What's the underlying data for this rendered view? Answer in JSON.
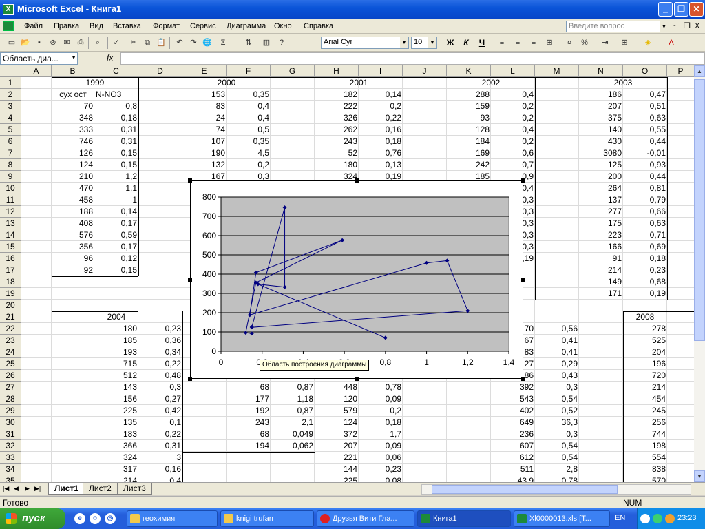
{
  "window": {
    "title": "Microsoft Excel - Книга1",
    "min": "_",
    "max": "❐",
    "close": "✕"
  },
  "menu": [
    "Файл",
    "Правка",
    "Вид",
    "Вставка",
    "Формат",
    "Сервис",
    "Диаграмма",
    "Окно",
    "Справка"
  ],
  "ask_placeholder": "Введите вопрос",
  "doc_controls": {
    "min": "-",
    "restore": "❐",
    "close": "x"
  },
  "toolbar": {
    "font": "Arial Cyr",
    "size": "10",
    "bold": "Ж",
    "italic": "К",
    "underline": "Ч",
    "sigma": "Σ",
    "percent": "%"
  },
  "namebox": "Область диа...",
  "fx": "fx",
  "columns": [
    "A",
    "B",
    "C",
    "D",
    "E",
    "F",
    "G",
    "H",
    "I",
    "J",
    "K",
    "L",
    "M",
    "N",
    "O",
    "P"
  ],
  "rows": [
    "1",
    "2",
    "3",
    "4",
    "5",
    "6",
    "7",
    "8",
    "9",
    "10",
    "11",
    "12",
    "13",
    "14",
    "15",
    "16",
    "17",
    "18",
    "19",
    "20",
    "21",
    "22",
    "23",
    "24",
    "25",
    "26",
    "27",
    "28",
    "29",
    "30",
    "31",
    "32",
    "33",
    "34",
    "35"
  ],
  "years_row1": [
    "1999",
    "2000",
    "2001",
    "2002",
    "2003"
  ],
  "headers": {
    "b2": "сух ост",
    "c2": "N-NO3"
  },
  "data1999": {
    "B": [
      "70",
      "348",
      "333",
      "746",
      "126",
      "124",
      "210",
      "470",
      "458",
      "188",
      "408",
      "576",
      "356",
      "96",
      "92"
    ],
    "C": [
      "0,8",
      "0,18",
      "0,31",
      "0,31",
      "0,15",
      "0,15",
      "1,2",
      "1,1",
      "1",
      "0,14",
      "0,17",
      "0,59",
      "0,17",
      "0,12",
      "0,15"
    ]
  },
  "data2000": {
    "E": [
      "153",
      "83",
      "24",
      "74",
      "107",
      "190",
      "132",
      "167"
    ],
    "F": [
      "0,35",
      "0,4",
      "0,4",
      "0,5",
      "0,35",
      "4,5",
      "0,2",
      "0,3"
    ]
  },
  "data2001": {
    "H": [
      "182",
      "222",
      "326",
      "262",
      "243",
      "52",
      "180",
      "324"
    ],
    "I": [
      "0,14",
      "0,2",
      "0,22",
      "0,16",
      "0,18",
      "0,76",
      "0,13",
      "0,19"
    ]
  },
  "data2002": {
    "K": [
      "288",
      "159",
      "93",
      "128",
      "184",
      "169",
      "242",
      "185"
    ],
    "L": [
      "0,4",
      "0,2",
      "0,2",
      "0,4",
      "0,2",
      "0,6",
      "0,7",
      "0,9",
      "0,4",
      "0,3",
      "0,3",
      "0,3",
      "0,3",
      "0,3",
      "0,19"
    ]
  },
  "data2003": {
    "N": [
      "186",
      "207",
      "375",
      "140",
      "430",
      "3080",
      "125",
      "200",
      "264",
      "137",
      "277",
      "175",
      "223",
      "166",
      "91",
      "214",
      "149",
      "171"
    ],
    "O": [
      "0,47",
      "0,51",
      "0,63",
      "0,55",
      "0,44",
      "-0,01",
      "0,93",
      "0,44",
      "0,81",
      "0,79",
      "0,66",
      "0,63",
      "0,71",
      "0,69",
      "0,18",
      "0,23",
      "0,68",
      "0,19"
    ]
  },
  "years_row21": {
    "y2004": "2004",
    "y2008": "2008"
  },
  "data2004": {
    "C": [
      "180",
      "185",
      "193",
      "715",
      "512",
      "143",
      "156",
      "225",
      "135",
      "183",
      "366",
      "324",
      "317",
      "214"
    ],
    "D": [
      "0,23",
      "0,36",
      "0,34",
      "0,22",
      "0,48",
      "0,3",
      "0,27",
      "0,42",
      "0,1",
      "0,22",
      "0,31",
      "3",
      "0,16",
      "0,4"
    ]
  },
  "data2005": {
    "F": [
      "68",
      "177",
      "192",
      "243",
      "68",
      "194"
    ],
    "G": [
      "0,87",
      "1,18",
      "0,87",
      "2,1",
      "0,049",
      "0,062"
    ]
  },
  "data2006": {
    "H": [
      "448",
      "120",
      "579",
      "124",
      "372",
      "207",
      "221",
      "144",
      "225"
    ],
    "I": [
      "0,78",
      "0,09",
      "0,2",
      "0,18",
      "1,7",
      "0,09",
      "0,06",
      "0,23",
      "0,08"
    ]
  },
  "data2007": {
    "L": [
      "70",
      "67",
      "83",
      "27",
      "86",
      "392",
      "543",
      "402",
      "649",
      "236",
      "607",
      "612",
      "511",
      "43,9"
    ],
    "M": [
      "0,56",
      "0,41",
      "0,41",
      "0,29",
      "0,43",
      "0,3",
      "0,54",
      "0,52",
      "36,3",
      "0,3",
      "0,54",
      "0,54",
      "2,8",
      "0,78"
    ]
  },
  "data2008": {
    "O": [
      "278",
      "525",
      "204",
      "196",
      "720",
      "214",
      "454",
      "245",
      "256",
      "744",
      "198",
      "554",
      "838",
      "570"
    ]
  },
  "tooltip": "Область построения диаграммы",
  "sheets": [
    "Лист1",
    "Лист2",
    "Лист3"
  ],
  "status": {
    "ready": "Готово",
    "num": "NUM"
  },
  "taskbar": {
    "start": "пуск",
    "tasks": [
      "геохимия",
      "knigi trufan",
      "Друзья Вити Гла...",
      "Книга1",
      "Xl0000013.xls [Т..."
    ],
    "lang": "EN",
    "clock": "23:23"
  },
  "chart_data": {
    "type": "scatter",
    "plot_background": "#c0c0c0",
    "line_color": "#000080",
    "x": [
      0.8,
      0.18,
      0.31,
      0.31,
      0.15,
      0.15,
      1.2,
      1.1,
      1,
      0.14,
      0.17,
      0.59,
      0.17,
      0.12,
      0.15
    ],
    "y": [
      70,
      348,
      333,
      746,
      126,
      124,
      210,
      470,
      458,
      188,
      408,
      576,
      356,
      96,
      92
    ],
    "xlim": [
      0,
      1.4
    ],
    "ylim": [
      0,
      800
    ],
    "xticks": [
      "0",
      "0,2",
      "0,4",
      "0,6",
      "0,8",
      "1",
      "1,2",
      "1,4"
    ],
    "yticks": [
      "0",
      "100",
      "200",
      "300",
      "400",
      "500",
      "600",
      "700",
      "800"
    ],
    "grid": true,
    "legend": "none"
  }
}
